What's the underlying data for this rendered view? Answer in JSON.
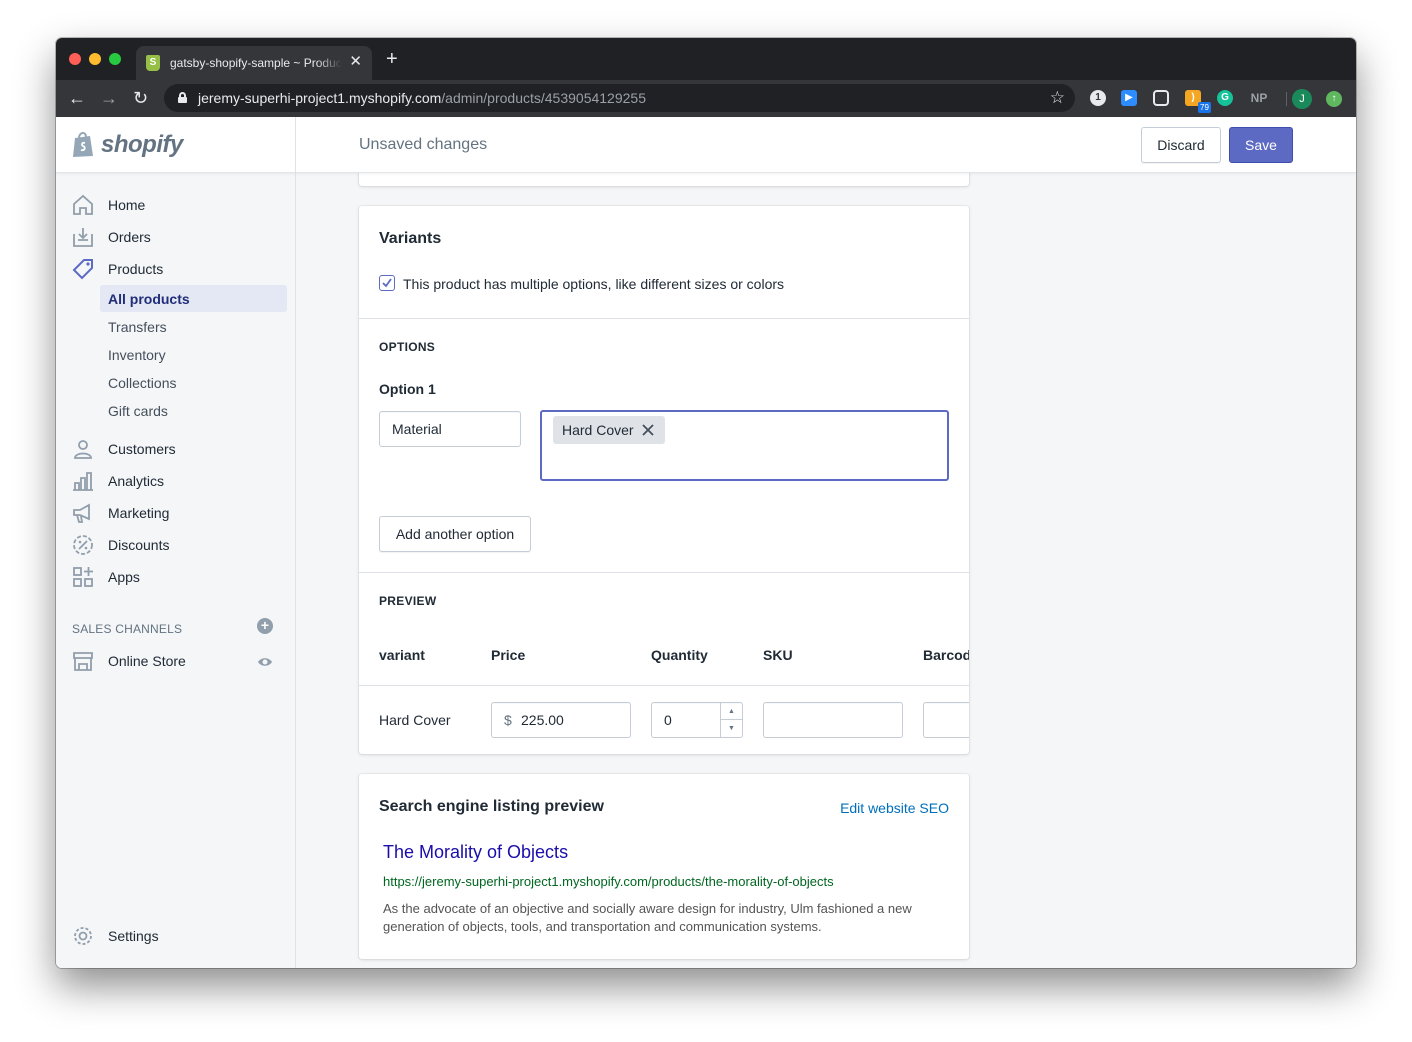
{
  "browser": {
    "tab_title": "gatsby-shopify-sample ~ Products",
    "url_host": "jeremy-superhi-project1.myshopify.com",
    "url_path": "/admin/products/4539054129255",
    "extension_badge": "79",
    "np_label": "NP",
    "profile_initial": "J"
  },
  "topbar": {
    "logo_text": "shopify",
    "status": "Unsaved changes",
    "discard_label": "Discard",
    "save_label": "Save"
  },
  "sidebar": {
    "items": [
      {
        "label": "Home",
        "icon": "home-icon"
      },
      {
        "label": "Orders",
        "icon": "orders-icon"
      },
      {
        "label": "Products",
        "icon": "tag-icon"
      },
      {
        "label": "Customers",
        "icon": "person-icon"
      },
      {
        "label": "Analytics",
        "icon": "bar-chart-icon"
      },
      {
        "label": "Marketing",
        "icon": "megaphone-icon"
      },
      {
        "label": "Discounts",
        "icon": "discount-icon"
      },
      {
        "label": "Apps",
        "icon": "apps-icon"
      }
    ],
    "product_subitems": [
      {
        "label": "All products",
        "active": true
      },
      {
        "label": "Transfers"
      },
      {
        "label": "Inventory"
      },
      {
        "label": "Collections"
      },
      {
        "label": "Gift cards"
      }
    ],
    "channels_header": "SALES CHANNELS",
    "online_store": "Online Store",
    "settings": "Settings"
  },
  "variants": {
    "title": "Variants",
    "checkbox_label": "This product has multiple options, like different sizes or colors",
    "checkbox_checked": true,
    "options_header": "OPTIONS",
    "option_label": "Option 1",
    "option_name": "Material",
    "option_tags": [
      "Hard Cover"
    ],
    "add_option_label": "Add another option",
    "preview_header": "PREVIEW",
    "columns": [
      "variant",
      "Price",
      "Quantity",
      "SKU",
      "Barcod"
    ],
    "rows": [
      {
        "variant": "Hard Cover",
        "currency": "$",
        "price": "225.00",
        "quantity": "0",
        "sku": "",
        "barcode": ""
      }
    ]
  },
  "seo": {
    "title": "Search engine listing preview",
    "edit_link": "Edit website SEO",
    "page_title": "The Morality of Objects",
    "page_url": "https://jeremy-superhi-project1.myshopify.com/products/the-morality-of-objects",
    "description": "As the advocate of an objective and socially aware design for industry, Ulm fashioned a new generation of objects, tools, and transportation and communication systems."
  },
  "colors": {
    "accent": "#5c6ac4",
    "link": "#006fbb",
    "seo_title": "#1a0dab",
    "seo_url": "#006621"
  }
}
